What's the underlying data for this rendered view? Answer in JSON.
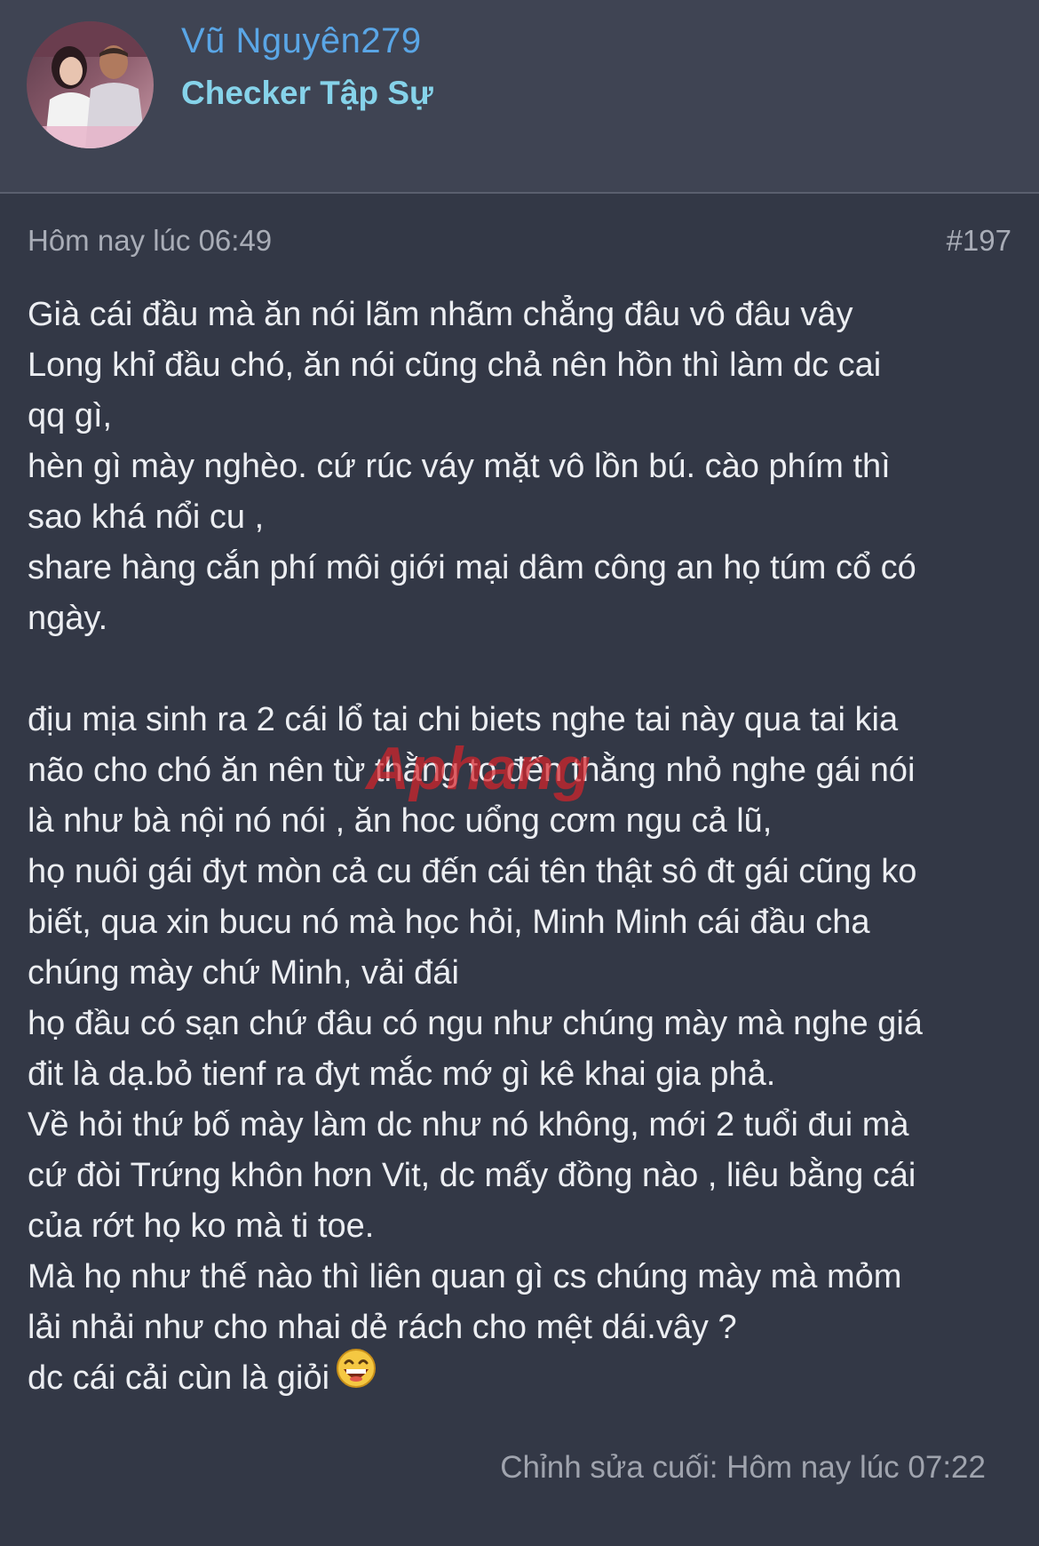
{
  "header": {
    "username": "Vũ Nguyên279",
    "user_title": "Checker Tập Sự"
  },
  "post": {
    "timestamp": "Hôm nay lúc 06:49",
    "post_number": "#197",
    "lines": [
      "Già cái đầu mà ăn nói lãm nhãm chẳng đâu vô đâu vây",
      "Long khỉ đầu chó, ăn nói cũng chả nên hồn thì làm dc cai",
      "qq gì,",
      "hèn gì mày nghèo. cứ rúc váy mặt vô lồn bú. cào phím thì",
      "sao khá nổi cu ,",
      "share hàng cắn phí môi giới mại dâm công an họ túm cổ có",
      "ngày.",
      "",
      "địu mịa sinh ra 2 cái lổ tai chi biets nghe tai này qua tai kia",
      "não cho chó ăn nên từ thằng to đến thằng nhỏ nghe gái nói",
      "là như bà nội nó nói , ăn hoc uổng cơm ngu cả lũ,",
      "họ nuôi gái đyt mòn cả cu đến cái tên thật sô đt gái cũng ko",
      "biết, qua xin bucu nó mà học hỏi, Minh Minh cái đầu cha",
      "chúng mày chứ Minh, vải đái",
      "họ đầu có sạn chứ đâu có ngu như chúng mày mà nghe giá",
      "đit là dạ.bỏ tienf ra đyt mắc mớ gì kê khai gia phả.",
      "Về hỏi thứ bố mày làm dc như nó không, mới 2 tuổi đui mà",
      "cứ đòi Trứng khôn hơn Vit, dc mấy đồng nào , liêu bằng cái",
      "của rớt họ ko mà ti toe.",
      "Mà họ như thế nào thì liên quan gì cs chúng mày mà mỏm",
      "lải nhải như cho nhai dẻ rách cho mệt dái.vây ?",
      "dc cái cải cùn là giỏi"
    ],
    "emoji": "laughing-face-emoji",
    "last_edited": "Chỉnh sửa cuối: Hôm nay lúc 07:22"
  },
  "watermark": {
    "text": "Aphang"
  },
  "colors": {
    "background": "#333846",
    "header_bg": "#3f4453",
    "username": "#5aa6e6",
    "user_title": "#86d3ea",
    "body_text": "#eceef2",
    "meta_text": "#a9adb7"
  }
}
